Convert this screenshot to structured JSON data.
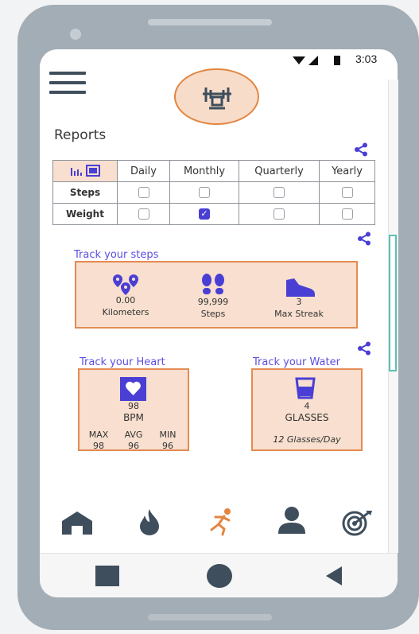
{
  "status_bar": {
    "time": "3:03"
  },
  "reports": {
    "title": "Reports",
    "columns": [
      "Daily",
      "Monthly",
      "Quarterly",
      "Yearly"
    ],
    "rows": [
      {
        "label": "Steps",
        "checked": [
          false,
          false,
          false,
          false
        ]
      },
      {
        "label": "Weight",
        "checked": [
          false,
          true,
          false,
          false
        ]
      }
    ]
  },
  "steps_section": {
    "title": "Track your steps",
    "stats": [
      {
        "value": "0.00",
        "label": "Kilometers",
        "icon": "location-pins-icon"
      },
      {
        "value": "99,999",
        "label": "Steps",
        "icon": "footprints-icon"
      },
      {
        "value": "3",
        "label": "Max Streak",
        "icon": "sneaker-icon"
      }
    ]
  },
  "heart_section": {
    "title": "Track your Heart",
    "value": "98",
    "unit": "BPM",
    "minmax": [
      {
        "label": "MAX",
        "value": "98"
      },
      {
        "label": "AVG",
        "value": "96"
      },
      {
        "label": "MIN",
        "value": "96"
      }
    ]
  },
  "water_section": {
    "title": "Track your Water",
    "value": "4",
    "unit": "GLASSES",
    "goal": "12 Glasses/Day"
  },
  "bottom_nav": [
    "home-icon",
    "flame-icon",
    "runner-icon",
    "profile-icon",
    "target-icon"
  ],
  "colors": {
    "accent": "#5b4fe0",
    "orange": "#e38540",
    "card_bg": "#f8dfcf",
    "teal": "#5ac2b3"
  }
}
